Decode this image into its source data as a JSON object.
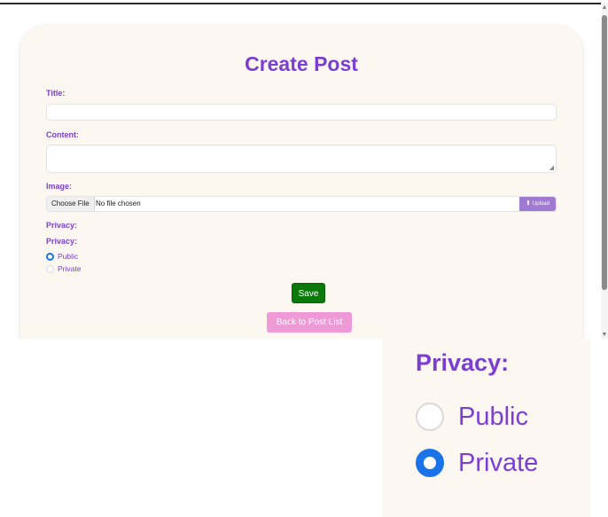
{
  "form": {
    "title": "Create Post",
    "title_label": "Title:",
    "title_value": "",
    "content_label": "Content:",
    "content_value": "",
    "image_label": "Image:",
    "choose_file_label": "Choose File",
    "file_status": "No file chosen",
    "upload_label": "Upload",
    "privacy_heading": "Privacy:",
    "privacy_label": "Privacy:",
    "privacy_options": [
      {
        "label": "Public",
        "selected": true
      },
      {
        "label": "Private",
        "selected": false
      }
    ],
    "save_label": "Save",
    "back_label": "Back to Post List"
  },
  "zoom_inset": {
    "privacy_label": "Privacy:",
    "privacy_options": [
      {
        "label": "Public",
        "selected": false
      },
      {
        "label": "Private",
        "selected": true
      }
    ]
  },
  "icons": {
    "upload": "upload-icon",
    "scroll_up": "scroll-up-arrow-icon",
    "scroll_down": "scroll-down-arrow-icon",
    "resize_grip": "resize-grip-icon"
  },
  "colors": {
    "accent_purple": "#7a3fd1",
    "save_green": "#0b7a0b",
    "back_pink": "#ee9ad6",
    "upload_purple": "#a07ad0",
    "radio_blue": "#1a73e8",
    "card_bg": "#fdf7f2"
  }
}
